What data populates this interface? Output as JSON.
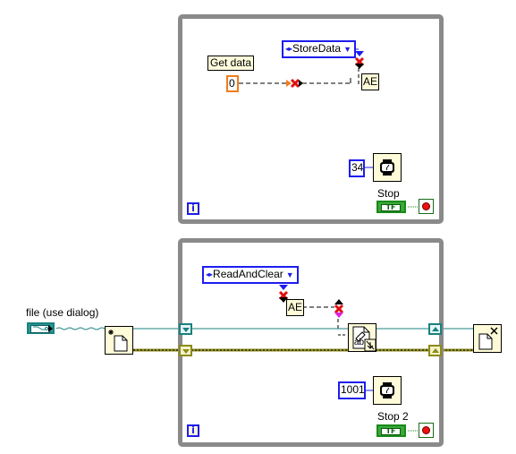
{
  "diagram": {
    "top_loop": {
      "type": "while-loop",
      "iteration_terminal": "i",
      "label_get_data": "Get data",
      "numeric_constant": "0",
      "enum_constant": "StoreData",
      "subvi_label": "AE",
      "wait_ms_constant": "34",
      "wait_icon": "wait-ms-icon",
      "stop_label": "Stop",
      "stop_bool_text": "TF"
    },
    "bottom_loop": {
      "type": "while-loop",
      "iteration_terminal": "i",
      "enum_constant": "ReadAndClear",
      "subvi_label": "AE",
      "write_icon_text": "ab",
      "wait_ms_constant": "1001",
      "wait_icon": "wait-ms-icon",
      "stop_label": "Stop 2",
      "stop_bool_text": "TF"
    },
    "outside": {
      "file_control_label": "file (use dialog)",
      "open_file_icon": "open-create-file-icon",
      "close_file_icon": "close-file-icon"
    },
    "colors": {
      "loop_border": "#8a8a8a",
      "enum_border": "#1d1df0",
      "numeric_orange": "#f07d1d",
      "refnum_wire": "#1a8080",
      "error_wire": "#8c8a1a",
      "boolean_green": "#1a8a1a",
      "broken_x": "#e01010",
      "magenta_terminal": "#e020e0"
    }
  }
}
